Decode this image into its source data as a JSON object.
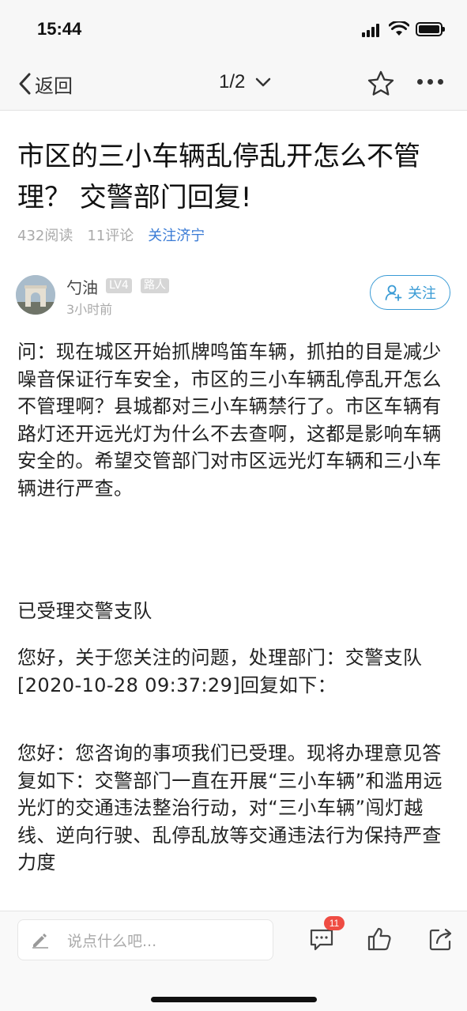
{
  "status_bar": {
    "time": "15:44"
  },
  "nav": {
    "back_label": "返回",
    "page_indicator": "1/2"
  },
  "article": {
    "title": "市区的三小车辆乱停乱开怎么不管理？ 交警部门回复!",
    "reads": "432阅读",
    "comments": "11评论",
    "topic_link": "关注济宁",
    "author": {
      "name": "勺油",
      "level_badge": "LV4",
      "role_badge": "路人",
      "time_ago": "3小时前",
      "follow_label": "关注"
    },
    "paragraphs": [
      "问：现在城区开始抓牌鸣笛车辆，抓拍的目是减少噪音保证行车安全，市区的三小车辆乱停乱开怎么不管理啊？县城都对三小车辆禁行了。市区车辆有路灯还开远光灯为什么不去查啊，这都是影响车辆安全的。希望交管部门对市区远光灯车辆和三小车辆进行严查。",
      "已受理交警支队",
      "您好，关于您关注的问题，处理部门：交警支队 [2020-10-28 09:37:29]回复如下：",
      "您好：您咨询的事项我们已受理。现将办理意见答复如下：交警部门一直在开展“三小车辆”和滥用远光灯的交通违法整治行动，对“三小车辆”闯灯越线、逆向行驶、乱停乱放等交通违法行为保持严查力度"
    ]
  },
  "bottom_bar": {
    "comment_placeholder": "说点什么吧...",
    "comment_count": "11"
  }
}
